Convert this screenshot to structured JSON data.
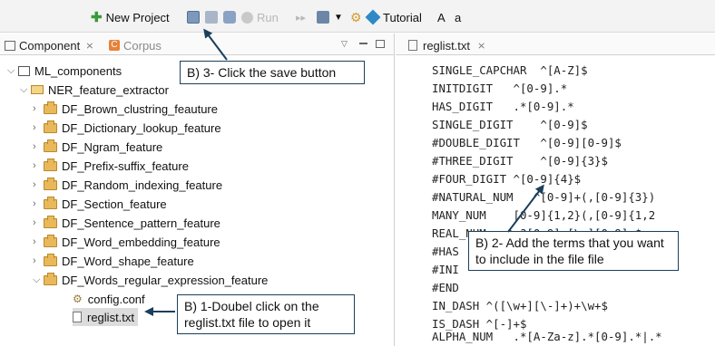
{
  "toolbar": {
    "new_project": "New Project",
    "run": "Run",
    "tutorial": "Tutorial",
    "a_upper": "A",
    "a_lower": "a"
  },
  "left_panel": {
    "tabs": [
      {
        "label": "Component",
        "close": "⨯"
      },
      {
        "label": "Corpus"
      }
    ],
    "tree": {
      "root": "ML_components",
      "project": "NER_feature_extractor",
      "items": [
        "DF_Brown_clustring_feauture",
        "DF_Dictionary_lookup_feature",
        "DF_Ngram_feature",
        "DF_Prefix-suffix_feature",
        "DF_Random_indexing_feature",
        "DF_Section_feature",
        "DF_Sentence_pattern_feature",
        "DF_Word_embedding_feature",
        "DF_Word_shape_feature",
        "DF_Words_regular_expression_feature"
      ],
      "files": [
        "config.conf",
        "reglist.txt"
      ]
    }
  },
  "editor": {
    "tab_label": "reglist.txt",
    "tab_close": "⨯",
    "lines": [
      "SINGLE_CAPCHAR  ^[A-Z]$",
      "INITDIGIT   ^[0-9].*",
      "HAS_DIGIT   .*[0-9].*",
      "SINGLE_DIGIT    ^[0-9]$",
      "#DOUBLE_DIGIT   ^[0-9][0-9]$",
      "#THREE_DIGIT    ^[0-9]{3}$",
      "#FOUR_DIGIT ^[0-9]{4}$",
      "#NATURAL_NUM   ^[0-9]+(,[0-9]{3})",
      "MANY_NUM    [0-9]{1,2}(,[0-9]{1,2",
      "REAL_NUM   ^-?[0-9]+[\\.][0-9]+$",
      "#HAS",
      "#INI",
      "#END",
      "IN_DASH ^([\\w+][\\-]+)+\\w+$",
      "IS_DASH ^[-]+$",
      "ALPHA_NUM   .*[A-Za-z].*[0-9].*|.*"
    ]
  },
  "callouts": {
    "save": "B) 3- Click the save button",
    "add_terms": "B) 2- Add the terms that you want to include in the file file",
    "open_file": "B) 1-Doubel click on the reglist.txt  file to open it"
  },
  "colors": {
    "callout_border": "#1a3f5c",
    "arrow": "#1a3f5c",
    "package_icon": "#e9b85a",
    "selection": "#dcdcdc"
  }
}
